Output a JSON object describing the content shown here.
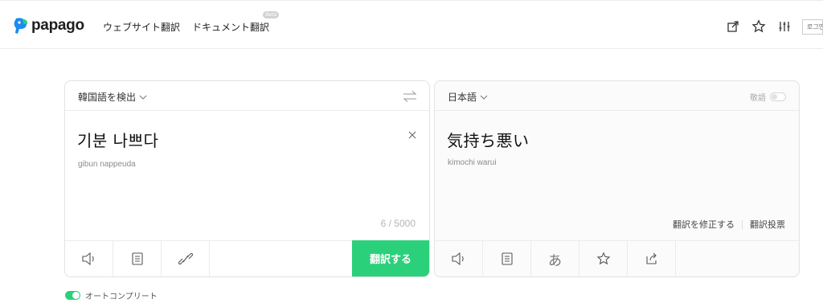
{
  "header": {
    "logo_text": "papago",
    "nav": [
      {
        "label": "ウェブサイト翻訳"
      },
      {
        "label": "ドキュメント翻訳",
        "badge": "Beta"
      }
    ],
    "login_label": "로그인"
  },
  "source": {
    "language_label": "韓国語を検出",
    "text": "기분 나쁘다",
    "pronunciation": "gibun nappeuda",
    "counter": "6 / 5000",
    "translate_label": "翻訳する"
  },
  "target": {
    "language_label": "日本語",
    "honorific_label": "敬語",
    "text": "気持ち悪い",
    "pronunciation": "kimochi warui",
    "edit_label": "翻訳を修正する",
    "vote_label": "翻訳投票",
    "kana_glyph": "あ"
  },
  "autocomplete": {
    "label": "オートコンプリート",
    "enabled": true
  },
  "colors": {
    "accent": "#2bd07a",
    "logo_blue": "#1b8cf2",
    "logo_green": "#2bd07a"
  },
  "icons": {
    "header": [
      "share-window-icon",
      "star-icon",
      "settings-sliders-icon"
    ],
    "source_tools": [
      "speaker-icon",
      "memo-icon",
      "link-icon"
    ],
    "target_tools": [
      "speaker-icon",
      "memo-icon",
      "kana-icon",
      "star-icon",
      "share-icon"
    ]
  }
}
